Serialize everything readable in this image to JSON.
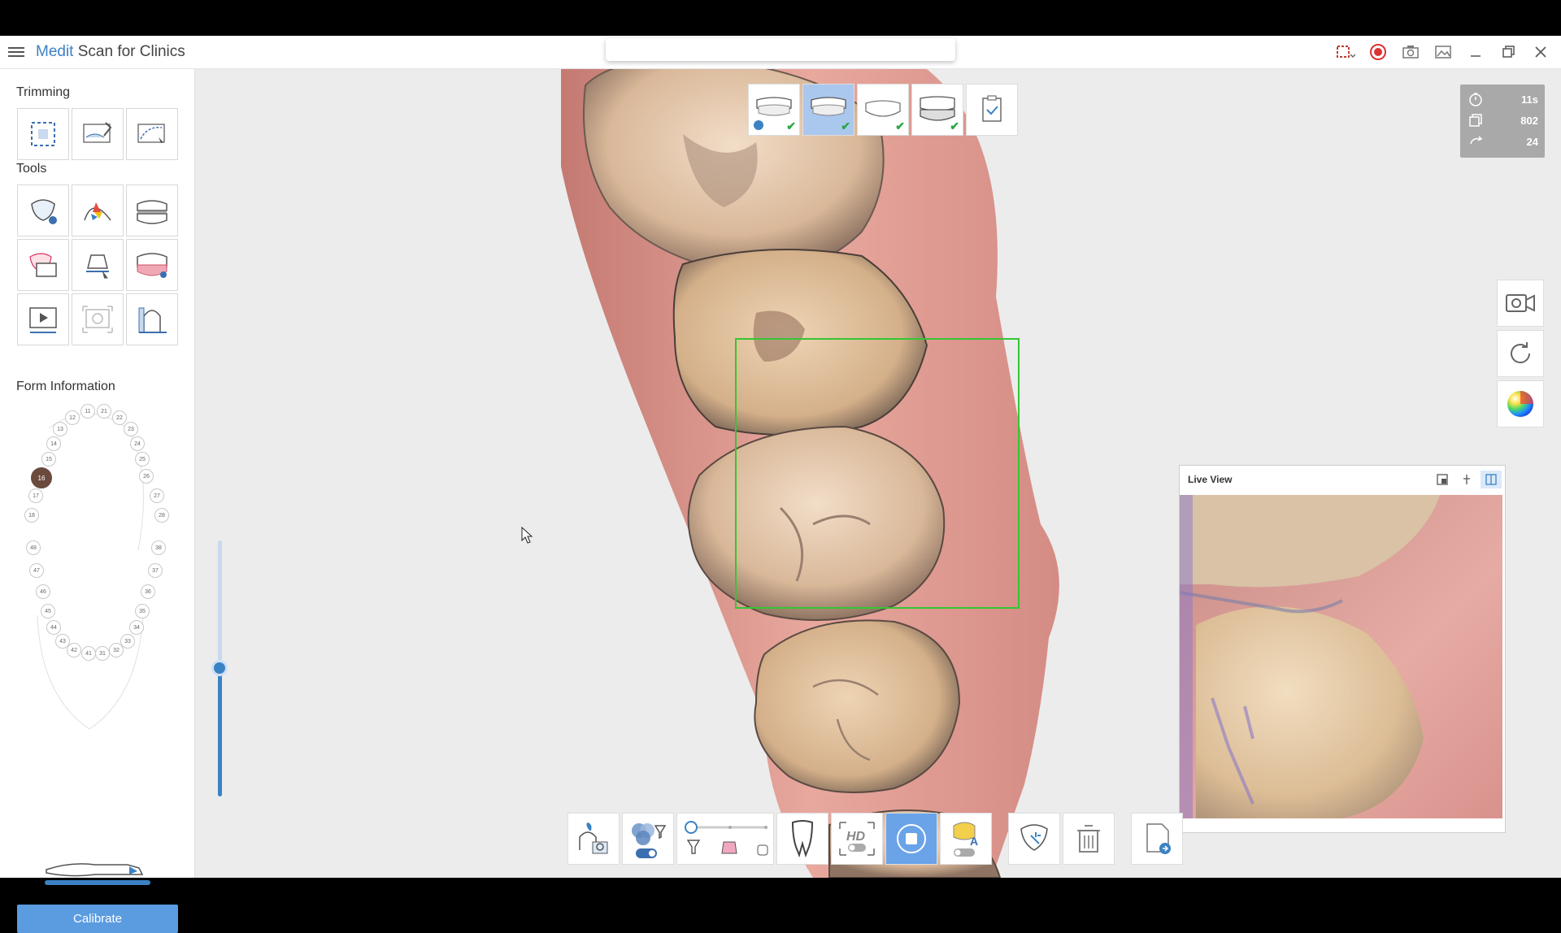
{
  "app": {
    "brand": "Medit",
    "name": " Scan for Clinics"
  },
  "window_controls": [
    "screen-capture-icon",
    "record-icon",
    "camera-icon",
    "image-icon",
    "minimize-icon",
    "restore-icon",
    "close-icon"
  ],
  "sidebar": {
    "trimming_title": "Trimming",
    "tools_title": "Tools",
    "form_title": "Form Information",
    "calibrate_label": "Calibrate",
    "active_tooth": "16",
    "teeth": [
      "11",
      "12",
      "13",
      "14",
      "15",
      "16",
      "17",
      "18",
      "21",
      "22",
      "23",
      "24",
      "25",
      "26",
      "27",
      "28",
      "31",
      "32",
      "33",
      "34",
      "35",
      "36",
      "37",
      "38",
      "41",
      "42",
      "43",
      "44",
      "45",
      "46",
      "47",
      "48"
    ]
  },
  "stats": {
    "time": "11s",
    "frames": "802",
    "rotation": "24"
  },
  "live_view": {
    "title": "Live View"
  },
  "colors": {
    "accent": "#3b82c4",
    "scan_box": "#34c634",
    "check": "#29a745",
    "active_tooth": "#6b4a3e"
  }
}
